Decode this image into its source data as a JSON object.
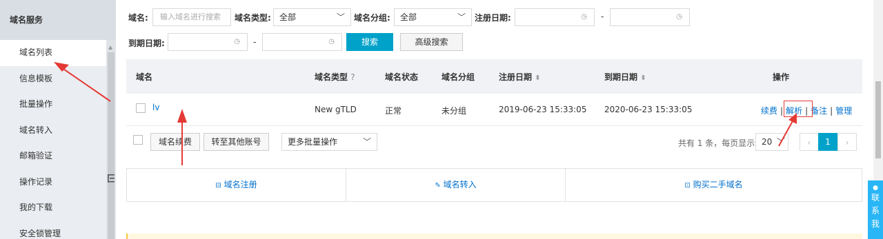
{
  "sidebar": {
    "title": "域名服务",
    "items": [
      {
        "label": "域名列表"
      },
      {
        "label": "信息模板"
      },
      {
        "label": "批量操作"
      },
      {
        "label": "域名转入"
      },
      {
        "label": "邮箱验证"
      },
      {
        "label": "操作记录"
      },
      {
        "label": "我的下载"
      },
      {
        "label": "安全锁管理"
      }
    ]
  },
  "search": {
    "domain_label": "域名:",
    "domain_placeholder": "输入域名进行搜索",
    "type_label": "域名类型:",
    "type_value": "全部",
    "group_label": "域名分组:",
    "group_value": "全部",
    "reg_label": "注册日期:",
    "exp_label": "到期日期:",
    "dash": "-",
    "search_btn": "搜索",
    "advanced_btn": "高级搜索"
  },
  "table": {
    "headers": {
      "domain": "域名",
      "type": "域名类型",
      "status": "域名状态",
      "group": "域名分组",
      "reg_date": "注册日期",
      "exp_date": "到期日期",
      "ops": "操作"
    },
    "rows": [
      {
        "domain": "lv",
        "type": "New gTLD",
        "status": "正常",
        "group": "未分组",
        "reg_date": "2019-06-23 15:33:05",
        "exp_date": "2020-06-23 15:33:05",
        "ops": [
          "续费",
          "解析",
          "备注",
          "管理"
        ]
      }
    ]
  },
  "footer": {
    "renew_btn": "域名续费",
    "transfer_btn": "转至其他账号",
    "batch_select": "更多批量操作",
    "total_text": "共有 1 条，每页显示:",
    "page_size": "20",
    "current_page": "1"
  },
  "actions": {
    "register": "域名注册",
    "transfer_in": "域名转入",
    "buy_second_hand": "购买二手域名"
  },
  "contact": {
    "label": "联系我"
  },
  "colors": {
    "primary": "#00a2ca",
    "link": "#0070cc",
    "annotation": "#e53935"
  }
}
